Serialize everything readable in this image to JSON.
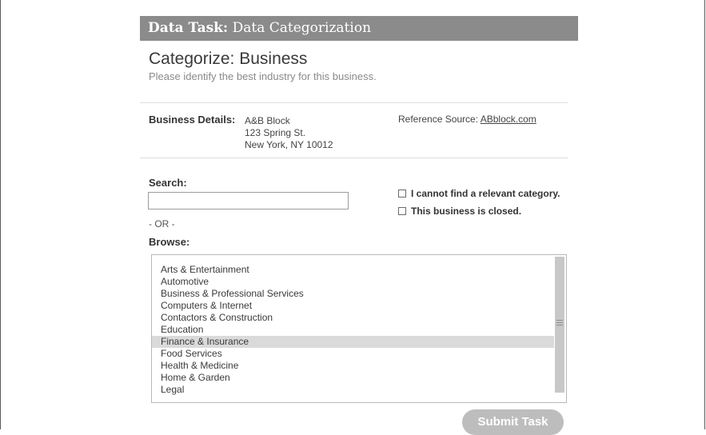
{
  "header": {
    "bold": "Data Task:",
    "rest": " Data Categorization"
  },
  "page": {
    "title": "Categorize: Business",
    "subtitle": "Please identify the best industry for this business."
  },
  "business": {
    "label": "Business Details:",
    "name": "A&B Block",
    "street": "123 Spring St.",
    "city": "New York, NY 10012",
    "reference_prefix": "Reference Source: ",
    "reference_link": "ABblock.com"
  },
  "search": {
    "label": "Search:",
    "value": "",
    "placeholder": ""
  },
  "or_text": "- OR -",
  "browse": {
    "label": "Browse:",
    "items": [
      "Arts & Entertainment",
      "Automotive",
      "Business & Professional Services",
      "Computers & Internet",
      "Contactors & Construction",
      "Education",
      "Finance & Insurance",
      "Food Services",
      "Health & Medicine",
      "Home & Garden",
      "Legal"
    ],
    "selected_index": 6
  },
  "options": {
    "no_category": {
      "label": "I cannot find a relevant category.",
      "checked": false
    },
    "closed": {
      "label": "This business is closed.",
      "checked": false
    }
  },
  "submit_label": "Submit Task",
  "colors": {
    "header_bg": "#8b8b8b",
    "selected_bg": "#dadada",
    "button_bg": "#bdbdbd",
    "scrollbar": "#c8c8c8"
  }
}
